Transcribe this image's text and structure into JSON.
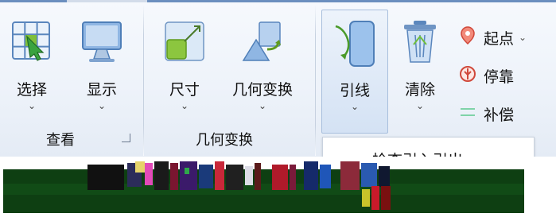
{
  "groups": {
    "view": {
      "label": "查看",
      "buttons": [
        {
          "label": "选择"
        },
        {
          "label": "显示"
        }
      ]
    },
    "geometry": {
      "label": "几何变换",
      "buttons": [
        {
          "label": "尺寸"
        },
        {
          "label": "几何变换"
        }
      ]
    },
    "lead": {
      "buttons": [
        {
          "label": "引线"
        },
        {
          "label": "清除"
        }
      ],
      "small_buttons": [
        {
          "label": "起点"
        },
        {
          "label": "停靠"
        },
        {
          "label": "补偿"
        }
      ]
    }
  },
  "popup": {
    "text": "检查引入引出"
  },
  "dropdown_glyph": "⌄",
  "colors": {
    "ribbon_bg": "#eef3fa",
    "accent_blue": "#6b8fbf",
    "artifact_green": "#0e3f12"
  }
}
